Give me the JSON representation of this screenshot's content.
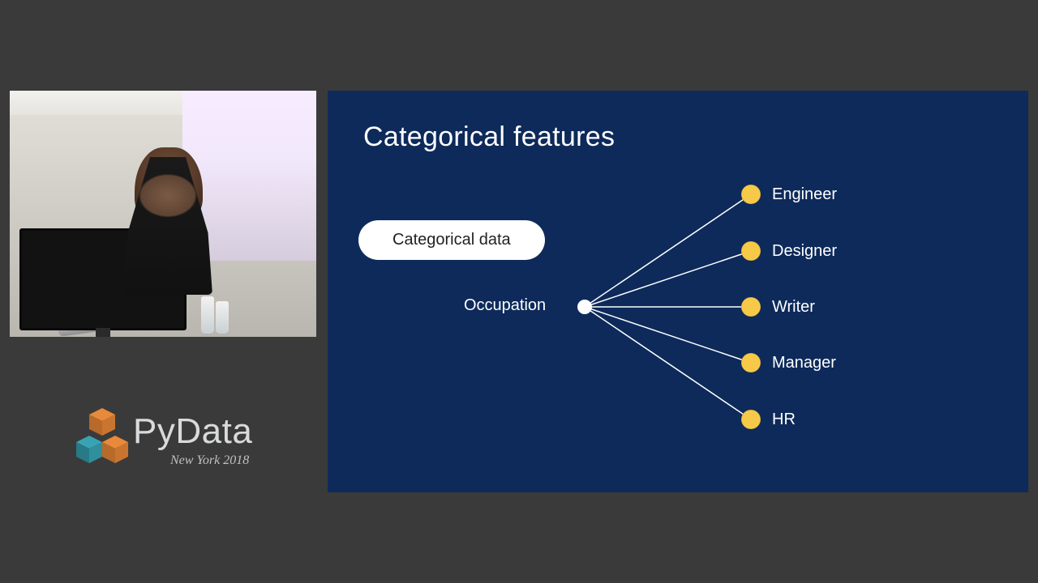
{
  "logo": {
    "brand_prefix": "Py",
    "brand_suffix": "Data",
    "subtitle": "New York 2018",
    "colors": {
      "orange": "#e98a3a",
      "teal": "#2f8f9d",
      "text": "#d8dadb"
    }
  },
  "slide": {
    "title": "Categorical features",
    "pill_label": "Categorical data",
    "root_label": "Occupation",
    "leaves": [
      "Engineer",
      "Designer",
      "Writer",
      "Manager",
      "HR"
    ],
    "colors": {
      "bg": "#0d2a5a",
      "accent": "#f7c948",
      "pill_bg": "#ffffff",
      "pill_text": "#222222"
    }
  }
}
